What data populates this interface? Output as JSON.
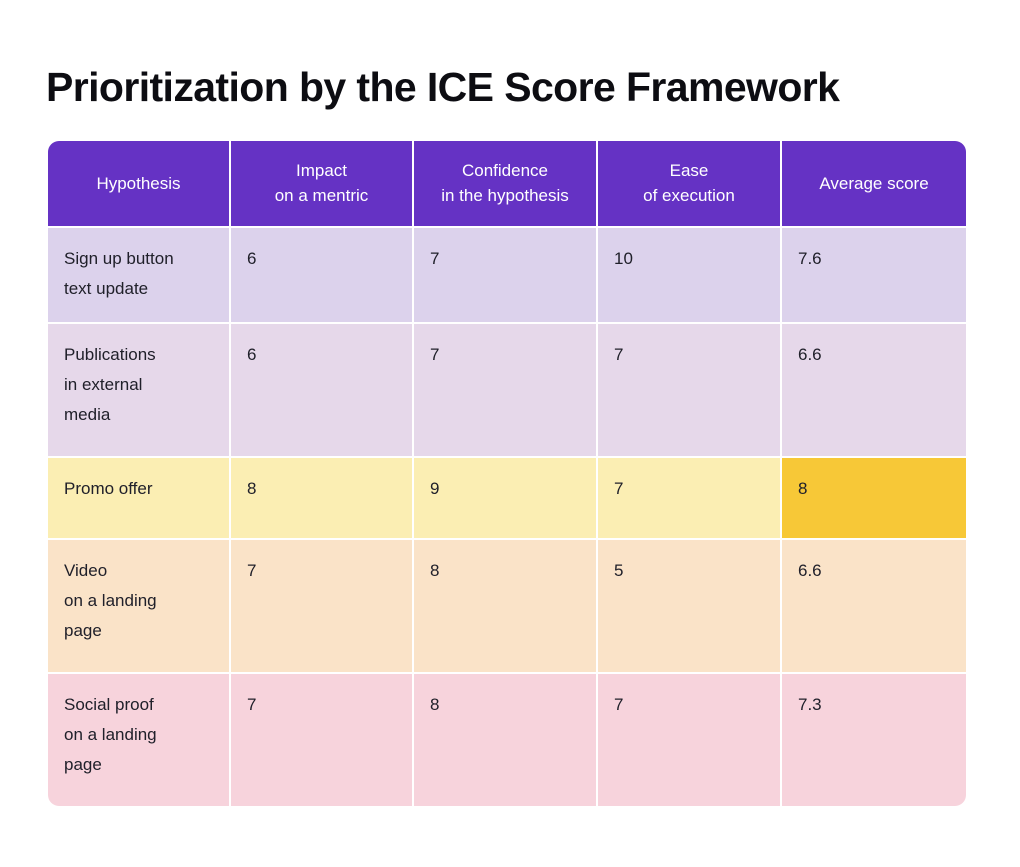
{
  "page": {
    "title": "Prioritization by the ICE Score Framework",
    "background_color": "#ffffff"
  },
  "colors": {
    "header_purple": "#6532C4",
    "header_text": "#ffffff",
    "row_1_lavender": "#DCD2EC",
    "row_2_lilac": "#E6D8EA",
    "row_3_yellow": "#FBEEB3",
    "row_4_peach": "#FAE3C8",
    "row_5_pink": "#F7D3DC",
    "highlight_amber": "#F7C837",
    "body_text": "#20202a",
    "gridline": "#ffffff"
  },
  "table": {
    "columns": [
      {
        "key": "hypothesis",
        "line1": "Hypothesis",
        "line2": ""
      },
      {
        "key": "impact",
        "line1": "Impact",
        "line2": "on a mentric"
      },
      {
        "key": "confidence",
        "line1": "Confidence",
        "line2": "in the hypothesis"
      },
      {
        "key": "ease",
        "line1": "Ease",
        "line2": "of execution"
      },
      {
        "key": "average",
        "line1": "Average score",
        "line2": ""
      }
    ],
    "rows": [
      {
        "hypothesis": "Sign up button\ntext update",
        "impact": "6",
        "confidence": "7",
        "ease": "10",
        "average": "7.6",
        "highlight": false
      },
      {
        "hypothesis": "Publications\nin external\nmedia",
        "impact": "6",
        "confidence": "7",
        "ease": "7",
        "average": "6.6",
        "highlight": false
      },
      {
        "hypothesis": "Promo offer",
        "impact": "8",
        "confidence": "9",
        "ease": "7",
        "average": "8",
        "highlight": true
      },
      {
        "hypothesis": "Video\non a landing\npage",
        "impact": "7",
        "confidence": "8",
        "ease": "5",
        "average": "6.6",
        "highlight": false
      },
      {
        "hypothesis": "Social proof\non a landing\npage",
        "impact": "7",
        "confidence": "8",
        "ease": "7",
        "average": "7.3",
        "highlight": false
      }
    ]
  },
  "chart_data": {
    "type": "table",
    "title": "Prioritization by the ICE Score Framework",
    "columns": [
      "Hypothesis",
      "Impact on a mentric",
      "Confidence in the hypothesis",
      "Ease of execution",
      "Average score"
    ],
    "categories": [
      "Sign up button text update",
      "Publications in external media",
      "Promo offer",
      "Video on a landing page",
      "Social proof on a landing page"
    ],
    "series": [
      {
        "name": "Impact on a mentric",
        "values": [
          6,
          6,
          8,
          7,
          7
        ]
      },
      {
        "name": "Confidence in the hypothesis",
        "values": [
          7,
          7,
          9,
          8,
          8
        ]
      },
      {
        "name": "Ease of execution",
        "values": [
          10,
          7,
          7,
          5,
          7
        ]
      },
      {
        "name": "Average score",
        "values": [
          7.6,
          6.6,
          8,
          6.6,
          7.3
        ]
      }
    ],
    "highlighted_cell": {
      "row": "Promo offer",
      "column": "Average score",
      "value": 8
    },
    "xlabel": "",
    "ylabel": "",
    "legend_position": "none",
    "grid": true
  }
}
